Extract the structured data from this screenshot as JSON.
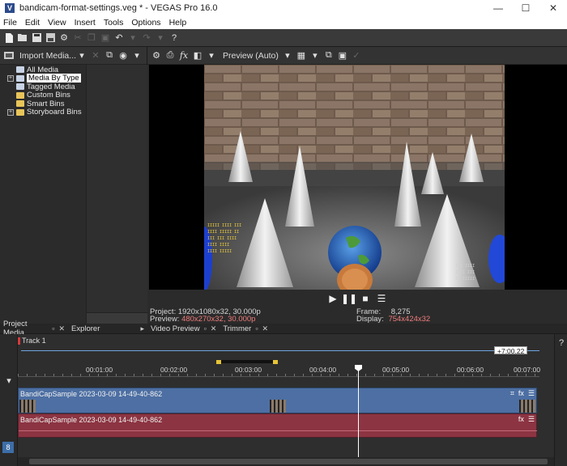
{
  "window": {
    "title": "bandicam-format-settings.veg * - VEGAS Pro 16.0",
    "logo": "V",
    "minimize": "—",
    "maximize": "☐",
    "close": "✕"
  },
  "menubar": [
    "File",
    "Edit",
    "View",
    "Insert",
    "Tools",
    "Options",
    "Help"
  ],
  "toolbar_icons": [
    "new-icon",
    "open-icon",
    "save-icon",
    "save-as-icon",
    "settings-icon",
    "cut-icon",
    "copy-icon",
    "paste-icon",
    "undo-icon",
    "redo-icon",
    "help-icon"
  ],
  "project_media": {
    "import_label": "Import Media...",
    "tree": [
      {
        "label": "All Media",
        "expander": "",
        "selected": false,
        "indent": 0
      },
      {
        "label": "Media By Type",
        "expander": "+",
        "selected": true,
        "indent": 0
      },
      {
        "label": "Tagged Media",
        "expander": "",
        "selected": false,
        "indent": 0
      },
      {
        "label": "Custom Bins",
        "expander": "",
        "selected": false,
        "indent": 1
      },
      {
        "label": "Smart Bins",
        "expander": "",
        "selected": false,
        "indent": 1
      },
      {
        "label": "Storyboard Bins",
        "expander": "+",
        "selected": false,
        "indent": 0
      }
    ]
  },
  "preview": {
    "mode_label": "Preview (Auto)",
    "project_label": "Project:",
    "project_value": "1920x1080x32, 30.000p",
    "preview_label": "Preview:",
    "preview_value": "480x270x32, 30.000p",
    "frame_label": "Frame:",
    "frame_value": "8,275",
    "display_label": "Display:",
    "display_value": "754x424x32"
  },
  "dock_tabs": [
    {
      "label": "Project Media"
    },
    {
      "label": "Explorer"
    },
    {
      "label": "Video Preview"
    },
    {
      "label": "Trimmer"
    }
  ],
  "timeline": {
    "track_name": "Track 1",
    "time_badge": "+7:00.22",
    "ruler": [
      "00:01:00",
      "00:02:00",
      "00:03:00",
      "00:04:00",
      "00:05:00",
      "00:06:00",
      "00:07:00"
    ],
    "video_clip": "BandiCapSample 2023-03-09 14-49-40-862",
    "audio_clip": "BandiCapSample 2023-03-09 14-49-40-862",
    "fx_label": "fx",
    "track_btn_label": "8"
  }
}
